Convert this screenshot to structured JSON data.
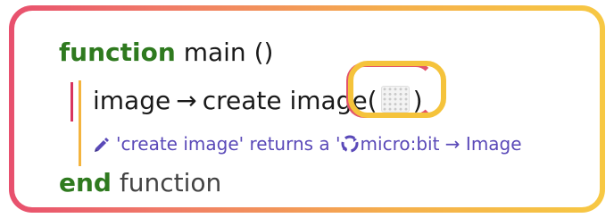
{
  "code": {
    "keyword_function": "function",
    "function_name": "main ()",
    "assign_target": "image",
    "arrow": "→",
    "call_name": "create image(",
    "call_close": ")",
    "hint": {
      "prefix": "'create image' returns a '",
      "type_name": "micro:bit",
      "arrow": "→",
      "type_member": "Image"
    },
    "keyword_end": "end",
    "end_label": "function"
  },
  "colors": {
    "keyword": "#2f7a1f",
    "hint": "#5a49b8",
    "frame_start": "#e8506e",
    "frame_end": "#f7c843",
    "statement_bar": "#d8345f",
    "block_bar": "#f4b43e"
  },
  "icons": {
    "hint_icon": "pencil-icon",
    "type_icon": "recycle-icon",
    "arg_icon": "led-grid-icon"
  }
}
